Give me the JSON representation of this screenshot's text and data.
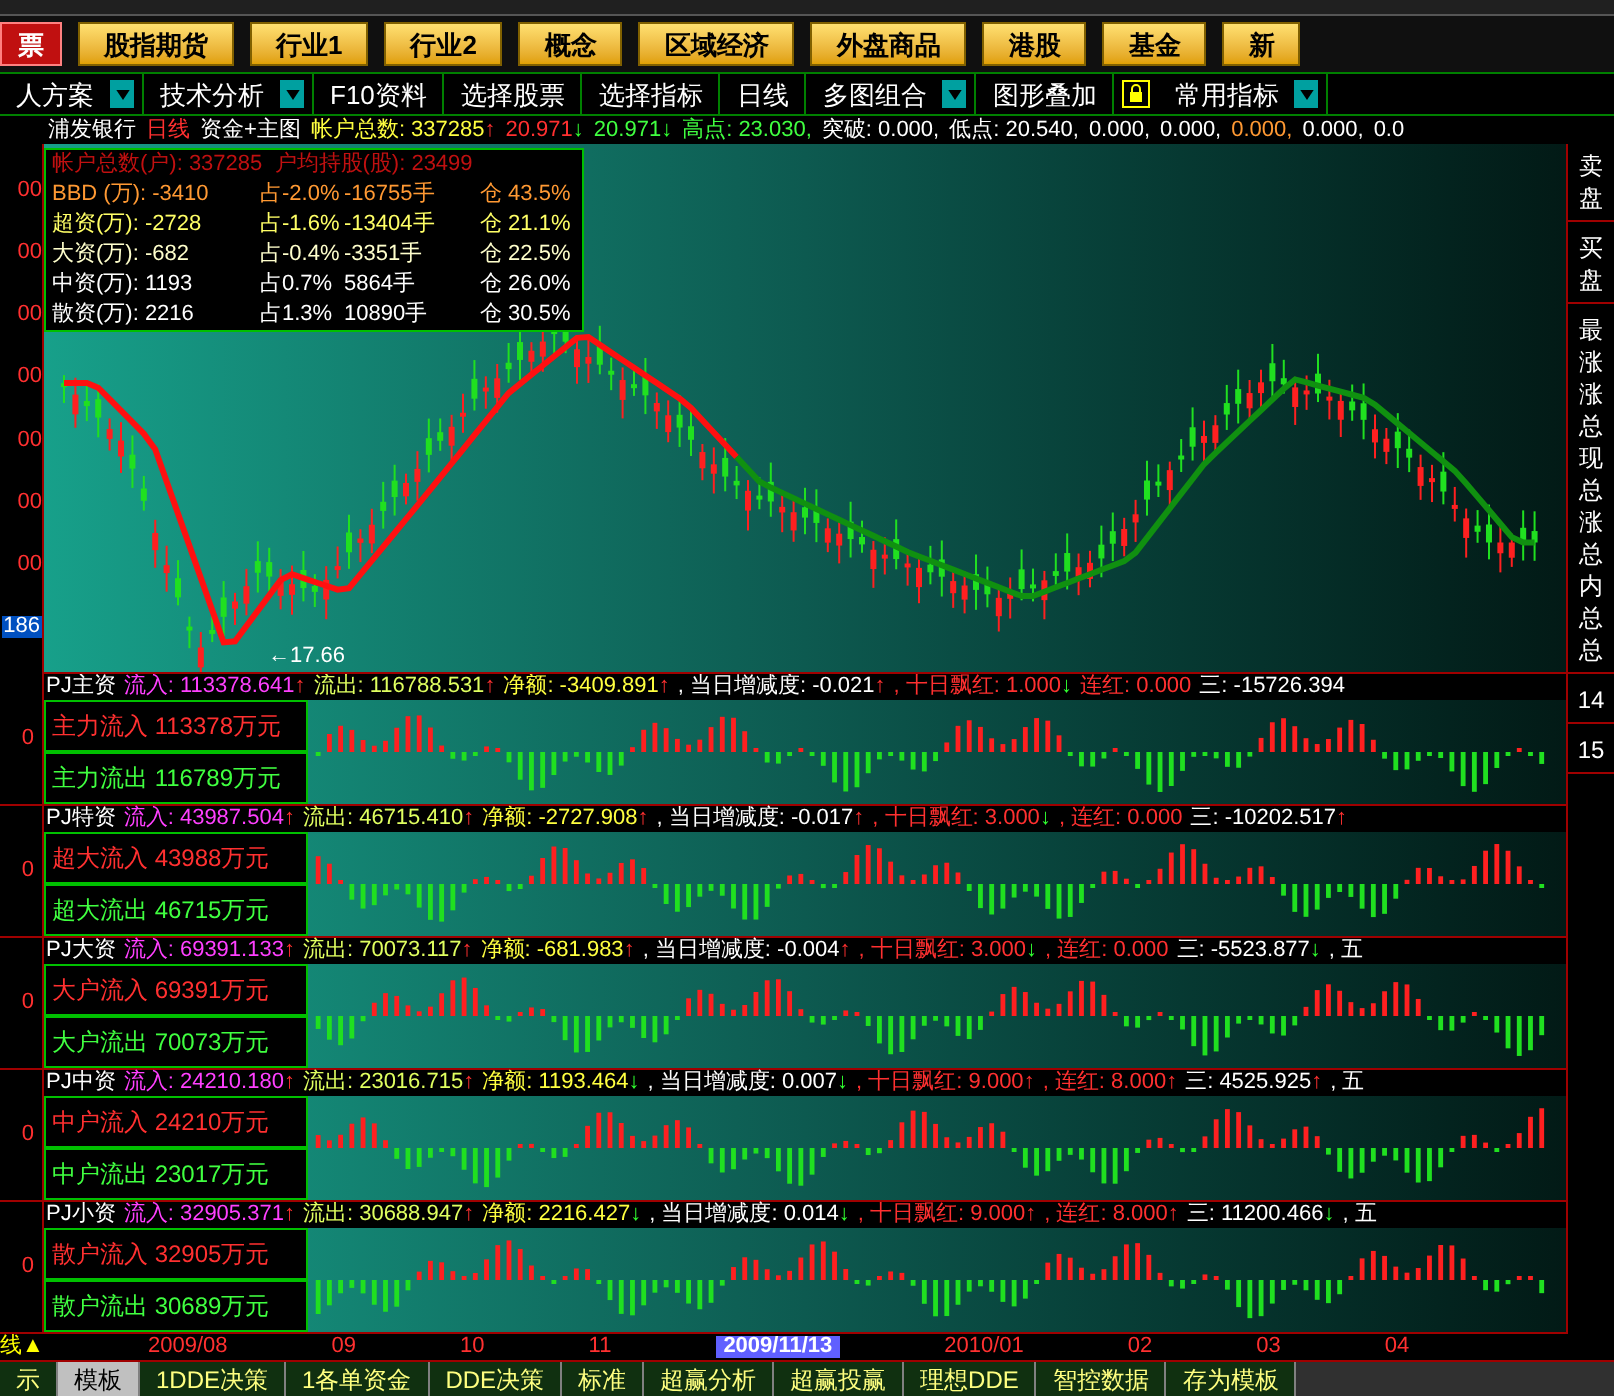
{
  "category_buttons": [
    {
      "label": "票",
      "kind": "active"
    },
    {
      "label": "股指期货",
      "kind": "normal"
    },
    {
      "label": "行业1",
      "kind": "normal"
    },
    {
      "label": "行业2",
      "kind": "normal"
    },
    {
      "label": "概念",
      "kind": "normal"
    },
    {
      "label": "区域经济",
      "kind": "normal"
    },
    {
      "label": "外盘商品",
      "kind": "normal"
    },
    {
      "label": "港股",
      "kind": "normal"
    },
    {
      "label": "基金",
      "kind": "normal"
    },
    {
      "label": "新",
      "kind": "normal"
    }
  ],
  "toolbar": [
    {
      "kind": "menu",
      "label": "人方案",
      "dropdown": true
    },
    {
      "kind": "menu",
      "label": "技术分析",
      "dropdown": true
    },
    {
      "kind": "menu",
      "label": "F10资料",
      "dropdown": false
    },
    {
      "kind": "menu",
      "label": "选择股票",
      "dropdown": false
    },
    {
      "kind": "menu",
      "label": "选择指标",
      "dropdown": false
    },
    {
      "kind": "menu",
      "label": "日线",
      "dropdown": false
    },
    {
      "kind": "menu",
      "label": "多图组合",
      "dropdown": true
    },
    {
      "kind": "menu",
      "label": "图形叠加",
      "dropdown": false
    },
    {
      "kind": "lock"
    },
    {
      "kind": "menu",
      "label": "常用指标",
      "dropdown": true
    }
  ],
  "info_line": [
    {
      "kind": "white",
      "text": "浦发银行"
    },
    {
      "kind": "red",
      "text": "日线"
    },
    {
      "kind": "white",
      "text": "资金+主图"
    },
    {
      "kind": "yellow",
      "text": "帐户总数: 337285",
      "arrow": "↑",
      "rising": true
    },
    {
      "kind": "red",
      "text": "20.971",
      "arrow": "↓",
      "rising": false
    },
    {
      "kind": "green",
      "text": "20.971",
      "arrow": "↓",
      "rising": false
    },
    {
      "kind": "green",
      "text": "高点: 23.030,"
    },
    {
      "kind": "white",
      "text": "突破: 0.000,"
    },
    {
      "kind": "white",
      "text": "低点: 20.540,"
    },
    {
      "kind": "white",
      "text": "0.000,"
    },
    {
      "kind": "white",
      "text": "0.000,"
    },
    {
      "kind": "orange",
      "text": "0.000,"
    },
    {
      "kind": "white",
      "text": "0.000,"
    },
    {
      "kind": "white",
      "text": "0.0"
    }
  ],
  "main_chart": {
    "y_axis_labels": [
      {
        "text": "00",
        "highlighted": false
      },
      {
        "text": "00",
        "highlighted": false
      },
      {
        "text": "00",
        "highlighted": false
      },
      {
        "text": "00",
        "highlighted": false
      },
      {
        "text": "00",
        "highlighted": false
      },
      {
        "text": "00",
        "highlighted": false
      },
      {
        "text": "00",
        "highlighted": false
      },
      {
        "text": "186",
        "highlighted": true
      }
    ],
    "low_marker": "←17.66",
    "stats_header": "帐户总数(户): 337285  户均持股(股): 23499",
    "stats": [
      {
        "name": "BBD (万): -3410",
        "share": "占-2.0%",
        "hands": "-16755手",
        "position": "仓 43.5%",
        "color": "#ff9933"
      },
      {
        "name": "超资(万): -2728",
        "share": "占-1.6%",
        "hands": "-13404手",
        "position": "仓 21.1%",
        "color": "#ffff66"
      },
      {
        "name": "大资(万): -682",
        "share": "占-0.4%",
        "hands": "-3351手",
        "position": "仓 22.5%",
        "color": "#ffffcc"
      },
      {
        "name": "中资(万): 1193",
        "share": "占0.7%",
        "hands": "5864手",
        "position": "仓 26.0%",
        "color": "#ffffff"
      },
      {
        "name": "散资(万): 2216",
        "share": "占1.3%",
        "hands": "10890手",
        "position": "仓 30.5%",
        "color": "#ffffff"
      }
    ]
  },
  "panels": [
    {
      "axis": "0",
      "inflow_legend": "主力流入 113378万元",
      "outflow_legend": "主力流出 116789万元",
      "header": [
        {
          "kind": "name",
          "text": "PJ主资"
        },
        {
          "kind": "inflow",
          "text": "流入: 113378.641",
          "arrow": "↑",
          "rising": true
        },
        {
          "kind": "outflow",
          "text": "流出: 116788.531",
          "arrow": "↑",
          "rising": true
        },
        {
          "kind": "net",
          "text": "净额: -3409.891",
          "arrow": "↑",
          "rising": true
        },
        {
          "kind": "change",
          "text": ", 当日增减度: -0.021",
          "arrow": "↑",
          "rising": true
        },
        {
          "kind": "tenday",
          "text": ", 十日飘红: 1.000",
          "arrow": "↓",
          "rising": false
        },
        {
          "kind": "streak",
          "text": "连红: 0.000"
        },
        {
          "kind": "name",
          "text": "三: -15726.394"
        }
      ]
    },
    {
      "axis": "0",
      "inflow_legend": "超大流入 43988万元",
      "outflow_legend": "超大流出 46715万元",
      "header": [
        {
          "kind": "name",
          "text": "PJ特资"
        },
        {
          "kind": "inflow",
          "text": "流入: 43987.504",
          "arrow": "↑",
          "rising": true
        },
        {
          "kind": "outflow",
          "text": "流出: 46715.410",
          "arrow": "↑",
          "rising": true
        },
        {
          "kind": "net",
          "text": "净额: -2727.908",
          "arrow": "↑",
          "rising": true
        },
        {
          "kind": "change",
          "text": ", 当日增减度: -0.017",
          "arrow": "↑",
          "rising": true
        },
        {
          "kind": "tenday",
          "text": ", 十日飘红: 3.000",
          "arrow": "↓",
          "rising": false
        },
        {
          "kind": "streak",
          "text": ", 连红: 0.000"
        },
        {
          "kind": "name",
          "text": "三: -10202.517",
          "arrow": "↑",
          "rising": true
        }
      ]
    },
    {
      "axis": "0",
      "inflow_legend": "大户流入 69391万元",
      "outflow_legend": "大户流出 70073万元",
      "header": [
        {
          "kind": "name",
          "text": "PJ大资"
        },
        {
          "kind": "inflow",
          "text": "流入: 69391.133",
          "arrow": "↑",
          "rising": true
        },
        {
          "kind": "outflow",
          "text": "流出: 70073.117",
          "arrow": "↑",
          "rising": true
        },
        {
          "kind": "net",
          "text": "净额: -681.983",
          "arrow": "↑",
          "rising": true
        },
        {
          "kind": "change",
          "text": ", 当日增减度: -0.004",
          "arrow": "↑",
          "rising": true
        },
        {
          "kind": "tenday",
          "text": ", 十日飘红: 3.000",
          "arrow": "↓",
          "rising": false
        },
        {
          "kind": "streak",
          "text": ", 连红: 0.000"
        },
        {
          "kind": "name",
          "text": "三: -5523.877",
          "arrow": "↓",
          "rising": false
        },
        {
          "kind": "name",
          "text": ", 五"
        }
      ]
    },
    {
      "axis": "0",
      "inflow_legend": "中户流入 24210万元",
      "outflow_legend": "中户流出 23017万元",
      "header": [
        {
          "kind": "name",
          "text": "PJ中资"
        },
        {
          "kind": "inflow",
          "text": "流入: 24210.180",
          "arrow": "↑",
          "rising": true
        },
        {
          "kind": "outflow",
          "text": "流出: 23016.715",
          "arrow": "↑",
          "rising": true
        },
        {
          "kind": "net",
          "text": "净额: 1193.464",
          "arrow": "↓",
          "rising": false
        },
        {
          "kind": "change",
          "text": ", 当日增减度: 0.007",
          "arrow": "↓",
          "rising": false
        },
        {
          "kind": "tenday",
          "text": ", 十日飘红: 9.000",
          "arrow": "↑",
          "rising": true
        },
        {
          "kind": "streak",
          "text": ", 连红: 8.000",
          "arrow": "↑",
          "rising": true
        },
        {
          "kind": "name",
          "text": "三: 4525.925",
          "arrow": "↑",
          "rising": true
        },
        {
          "kind": "name",
          "text": ", 五"
        }
      ]
    },
    {
      "axis": "0",
      "inflow_legend": "散户流入 32905万元",
      "outflow_legend": "散户流出 30689万元",
      "header": [
        {
          "kind": "name",
          "text": "PJ小资"
        },
        {
          "kind": "inflow",
          "text": "流入: 32905.371",
          "arrow": "↑",
          "rising": true
        },
        {
          "kind": "outflow",
          "text": "流出: 30688.947",
          "arrow": "↑",
          "rising": true
        },
        {
          "kind": "net",
          "text": "净额: 2216.427",
          "arrow": "↓",
          "rising": false
        },
        {
          "kind": "change",
          "text": ", 当日增减度: 0.014",
          "arrow": "↓",
          "rising": false
        },
        {
          "kind": "tenday",
          "text": ", 十日飘红: 9.000",
          "arrow": "↑",
          "rising": true
        },
        {
          "kind": "streak",
          "text": ", 连红: 8.000",
          "arrow": "↑",
          "rising": true
        },
        {
          "kind": "name",
          "text": "三: 11200.466",
          "arrow": "↓",
          "rising": false
        },
        {
          "kind": "name",
          "text": ", 五"
        }
      ]
    }
  ],
  "sidebar": [
    {
      "items": [
        "卖",
        "盘"
      ]
    },
    {
      "items": [
        "买",
        "盘"
      ]
    },
    {
      "items": [
        "最",
        "涨",
        "涨",
        "总",
        "现",
        "总",
        "涨",
        "总",
        "内",
        "总",
        "总"
      ]
    },
    {
      "items": [
        "14"
      ]
    },
    {
      "items": [
        "15"
      ]
    }
  ],
  "date_axis": {
    "marker": "线▲",
    "dates": [
      {
        "text": "2009/08",
        "selected": false
      },
      {
        "text": "09",
        "selected": false
      },
      {
        "text": "10",
        "selected": false
      },
      {
        "text": "11",
        "selected": false
      },
      {
        "text": "2009/11/13",
        "selected": true
      },
      {
        "text": "2010/01",
        "selected": false
      },
      {
        "text": "02",
        "selected": false
      },
      {
        "text": "03",
        "selected": false
      },
      {
        "text": "04",
        "selected": false
      }
    ]
  },
  "bottom_tabs": [
    {
      "label": "示",
      "selected": false
    },
    {
      "label": "模板",
      "selected": true
    },
    {
      "label": "1DDE决策",
      "selected": false
    },
    {
      "label": "1各单资金",
      "selected": false
    },
    {
      "label": "DDE决策",
      "selected": false
    },
    {
      "label": "标准",
      "selected": false
    },
    {
      "label": "超赢分析",
      "selected": false
    },
    {
      "label": "超赢投赢",
      "selected": false
    },
    {
      "label": "理想DDE",
      "selected": false
    },
    {
      "label": "智控数据",
      "selected": false
    },
    {
      "label": "存为模板",
      "selected": false
    }
  ]
}
